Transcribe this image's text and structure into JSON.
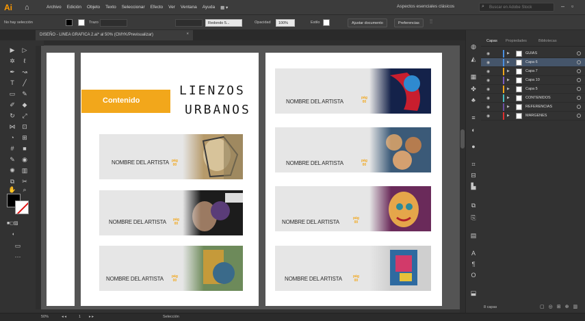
{
  "app": {
    "logo": "Ai"
  },
  "menubar": {
    "items": [
      "Archivo",
      "Edición",
      "Objeto",
      "Texto",
      "Seleccionar",
      "Efecto",
      "Ver",
      "Ventana",
      "Ayuda"
    ],
    "workspace": "Aspectos esenciales clásicos",
    "search_placeholder": "Buscar en Adobe Stock"
  },
  "controlbar": {
    "selection_label": "No hay selección",
    "trazo_label": "Trazo",
    "style": "Redondo 5...",
    "opacity_label": "Opacidad",
    "opacity_value": "100%",
    "estilo_label": "Estilo",
    "ajustar_button": "Ajustar documento",
    "preferencias_button": "Preferencias"
  },
  "document": {
    "tab_title": "DISEÑO - LINEA GRAFICA 2.ai* al 50% (CMYK/Previsualizar)"
  },
  "page_left": {
    "contenido_label": "Contenido",
    "title_line1": "LIENZOS",
    "title_line2": "URBANOS",
    "cards": [
      {
        "artist": "NOMBRE DEL ARTISTA",
        "pag": "pág",
        "num": "00"
      },
      {
        "artist": "NOMBRE DEL ARTISTA",
        "pag": "pág",
        "num": "00"
      },
      {
        "artist": "NOMBRE DEL ARTISTA",
        "pag": "pág",
        "num": "00"
      }
    ]
  },
  "page_right": {
    "cards": [
      {
        "artist": "NOMBRE DEL ARTISTA",
        "pag": "pág",
        "num": "00"
      },
      {
        "artist": "NOMBRE DEL ARTISTA",
        "pag": "pág",
        "num": "00"
      },
      {
        "artist": "NOMBRE DEL ARTISTA",
        "pag": "pág",
        "num": "00"
      },
      {
        "artist": "NOMBRE DEL ARTISTA",
        "pag": "pág",
        "num": "00"
      }
    ]
  },
  "layers_panel": {
    "tabs": [
      "Capas",
      "Propiedades",
      "Bibliotecas"
    ],
    "layers": [
      {
        "name": "GUIAS",
        "color": "#4a90e2",
        "selected": false
      },
      {
        "name": "Capa 6",
        "color": "#4a90e2",
        "selected": true
      },
      {
        "name": "Capa 7",
        "color": "#f2a71b",
        "selected": false
      },
      {
        "name": "Capa 10",
        "color": "#7a5cc0",
        "selected": false
      },
      {
        "name": "Capa 5",
        "color": "#f2a71b",
        "selected": false
      },
      {
        "name": "CONTENIDOS",
        "color": "#4ac0c0",
        "selected": false
      },
      {
        "name": "REFERENCIAS",
        "color": "#6b4fa0",
        "selected": false
      },
      {
        "name": "MARGENES",
        "color": "#e03030",
        "selected": false
      }
    ],
    "footer": "8 capas"
  },
  "statusbar": {
    "zoom": "50%",
    "page": "1",
    "tool": "Selección"
  },
  "colors": {
    "accent": "#f2a71b",
    "selected_layer": "#45556a"
  }
}
